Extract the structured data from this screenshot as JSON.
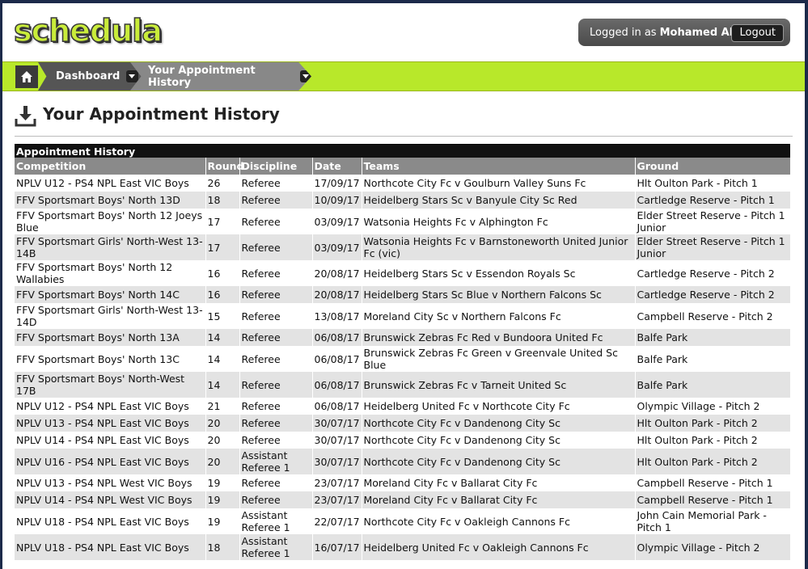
{
  "app": {
    "logo": "schedula"
  },
  "header": {
    "logged_in_prefix": "Logged in as",
    "user_name": "Mohamed Abdi",
    "logout_label": "Logout"
  },
  "nav": {
    "crumbs": [
      "Dashboard",
      "Your Appointment History"
    ]
  },
  "page": {
    "title": "Your Appointment History"
  },
  "table": {
    "caption": "Appointment History",
    "columns": [
      "Competition",
      "Round",
      "Discipline",
      "Date",
      "Teams",
      "Ground"
    ],
    "rows": [
      [
        "NPLV U12 - PS4 NPL East VIC Boys",
        "26",
        "Referee",
        "17/09/17",
        "Northcote City Fc v Goulburn Valley Suns Fc",
        "Hlt Oulton Park - Pitch 1"
      ],
      [
        "FFV Sportsmart Boys' North 13D",
        "18",
        "Referee",
        "10/09/17",
        "Heidelberg Stars Sc v Banyule City Sc Red",
        "Cartledge Reserve - Pitch 1"
      ],
      [
        "FFV Sportsmart Boys' North 12 Joeys Blue",
        "17",
        "Referee",
        "03/09/17",
        "Watsonia Heights Fc v Alphington Fc",
        "Elder Street Reserve - Pitch 1 Junior"
      ],
      [
        "FFV Sportsmart Girls' North-West 13-14B",
        "17",
        "Referee",
        "03/09/17",
        "Watsonia Heights Fc v Barnstoneworth United Junior Fc (vic)",
        "Elder Street Reserve - Pitch 1 Junior"
      ],
      [
        "FFV Sportsmart Boys' North 12 Wallabies",
        "16",
        "Referee",
        "20/08/17",
        "Heidelberg Stars Sc v Essendon Royals Sc",
        "Cartledge Reserve - Pitch 2"
      ],
      [
        "FFV Sportsmart Boys' North 14C",
        "16",
        "Referee",
        "20/08/17",
        "Heidelberg Stars Sc Blue v Northern Falcons Sc",
        "Cartledge Reserve - Pitch 2"
      ],
      [
        "FFV Sportsmart Girls' North-West 13-14D",
        "15",
        "Referee",
        "13/08/17",
        "Moreland City Sc v Northern Falcons Fc",
        "Campbell Reserve - Pitch 2"
      ],
      [
        "FFV Sportsmart Boys' North 13A",
        "14",
        "Referee",
        "06/08/17",
        "Brunswick Zebras Fc Red v Bundoora United Fc",
        "Balfe Park"
      ],
      [
        "FFV Sportsmart Boys' North 13C",
        "14",
        "Referee",
        "06/08/17",
        "Brunswick Zebras Fc Green v Greenvale United Sc Blue",
        "Balfe Park"
      ],
      [
        "FFV Sportsmart Boys' North-West 17B",
        "14",
        "Referee",
        "06/08/17",
        "Brunswick Zebras Fc v Tarneit United Sc",
        "Balfe Park"
      ],
      [
        "NPLV U12 - PS4 NPL East VIC Boys",
        "21",
        "Referee",
        "06/08/17",
        "Heidelberg United Fc v Northcote City Fc",
        "Olympic Village - Pitch 2"
      ],
      [
        "NPLV U13 - PS4 NPL East VIC Boys",
        "20",
        "Referee",
        "30/07/17",
        "Northcote City Fc v Dandenong City Sc",
        "Hlt Oulton Park - Pitch 2"
      ],
      [
        "NPLV U14 - PS4 NPL East VIC Boys",
        "20",
        "Referee",
        "30/07/17",
        "Northcote City Fc v Dandenong City Sc",
        "Hlt Oulton Park - Pitch 2"
      ],
      [
        "NPLV U16 - PS4 NPL East VIC Boys",
        "20",
        "Assistant Referee 1",
        "30/07/17",
        "Northcote City Fc v Dandenong City Sc",
        "Hlt Oulton Park - Pitch 2"
      ],
      [
        "NPLV U13 - PS4 NPL West VIC Boys",
        "19",
        "Referee",
        "23/07/17",
        "Moreland City Fc v Ballarat City Fc",
        "Campbell Reserve - Pitch 1"
      ],
      [
        "NPLV U14 - PS4 NPL West VIC Boys",
        "19",
        "Referee",
        "23/07/17",
        "Moreland City Fc v Ballarat City Fc",
        "Campbell Reserve - Pitch 1"
      ],
      [
        "NPLV U18 - PS4 NPL East VIC Boys",
        "19",
        "Assistant Referee 1",
        "22/07/17",
        "Northcote City Fc v Oakleigh Cannons Fc",
        "John Cain Memorial Park - Pitch 1"
      ],
      [
        "NPLV U18 - PS4 NPL East VIC Boys",
        "18",
        "Assistant Referee 1",
        "16/07/17",
        "Heidelberg United Fc v Oakleigh Cannons Fc",
        "Olympic Village - Pitch 2"
      ]
    ]
  }
}
